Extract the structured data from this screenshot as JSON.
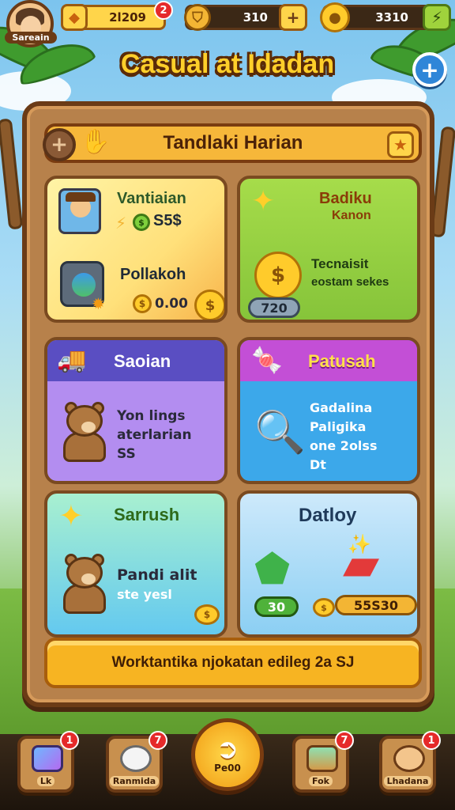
{
  "player": {
    "name": "Sareain"
  },
  "resources": {
    "gems": {
      "value": "2l209",
      "icon": "diamond-icon",
      "badge": "2"
    },
    "shields": {
      "value": "310",
      "icon": "shield-coin-icon",
      "plus": "+"
    },
    "coins": {
      "value": "3310",
      "icon": "gold-coin-icon"
    }
  },
  "game_title": "Casual at Idadan",
  "top_plus": "+",
  "panel": {
    "title": "Tandlaki Harian",
    "cards": [
      {
        "title": "Vantiaian",
        "value": "S5$",
        "sub_title": "Pollakoh",
        "sub_value": "0.00"
      },
      {
        "title": "Badiku",
        "subtitle": "Kanon",
        "line1": "Tecnaisit",
        "line2": "eostam sekes",
        "pill": "720"
      },
      {
        "title": "Saoian",
        "line1": "Yon lings",
        "line2": "aterlarian",
        "line3": "SS"
      },
      {
        "title": "Patusah",
        "line1": "Gadalina",
        "line2": "Paligika",
        "line3": "one 2olss",
        "line4": "Dt"
      },
      {
        "title": "Sarrush",
        "line1": "Pandi alit",
        "line2": "ste yesl"
      },
      {
        "title": "Datloy",
        "value1": "30",
        "value2": "55S30"
      }
    ],
    "cta": "Worktantika njokatan edileg 2a SJ"
  },
  "bottom_nav": [
    {
      "label": "Lk",
      "badge": "1",
      "icon": "crystal-icon"
    },
    {
      "label": "Ranmida",
      "badge": "7",
      "icon": "polar-bear-icon"
    },
    {
      "label": "Pe00",
      "icon": "play-arrow-icon"
    },
    {
      "label": "Fok",
      "badge": "7",
      "icon": "chest-icon"
    },
    {
      "label": "Lhadana",
      "badge": "1",
      "icon": "character-icon"
    }
  ],
  "colors": {
    "accent": "#f7b422",
    "wood": "#b7814b",
    "header": "#f6b73a",
    "badge": "#e52a2a"
  }
}
